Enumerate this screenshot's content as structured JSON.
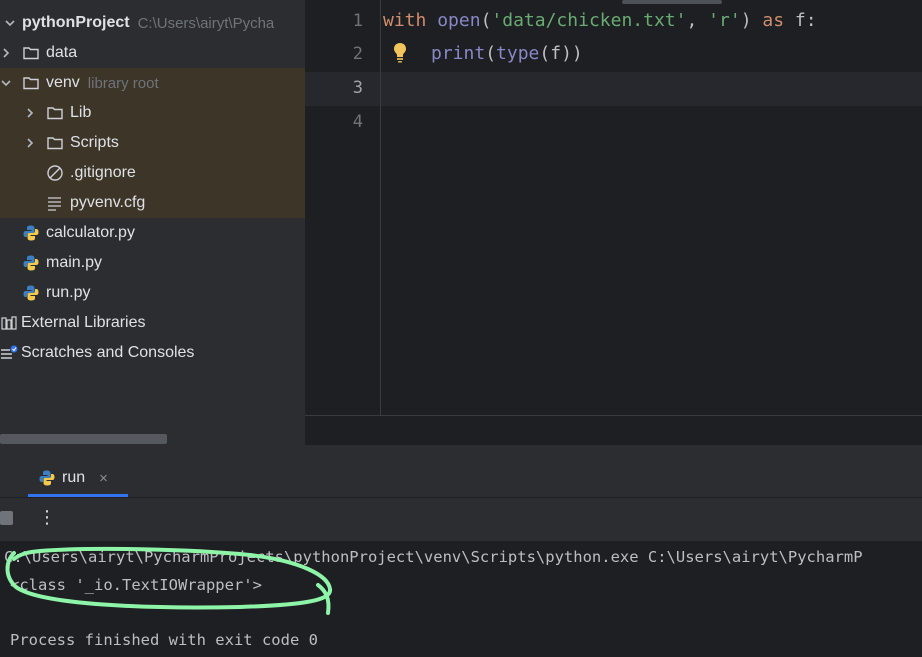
{
  "project": {
    "root_name": "pythonProject",
    "root_path": "C:\\Users\\airyt\\Pycha",
    "items": [
      {
        "label": "data",
        "icon": "folder-icon"
      },
      {
        "label": "venv",
        "sub": "library root",
        "icon": "folder-icon"
      },
      {
        "label": "Lib",
        "icon": "folder-icon"
      },
      {
        "label": "Scripts",
        "icon": "folder-icon"
      },
      {
        "label": ".gitignore",
        "icon": "ignore-file-icon"
      },
      {
        "label": "pyvenv.cfg",
        "icon": "text-file-icon"
      },
      {
        "label": "calculator.py",
        "icon": "python-file-icon"
      },
      {
        "label": "main.py",
        "icon": "python-file-icon"
      },
      {
        "label": "run.py",
        "icon": "python-file-icon"
      },
      {
        "label": "External Libraries",
        "icon": "library-icon"
      },
      {
        "label": "Scratches and Consoles",
        "icon": "scratches-icon"
      }
    ]
  },
  "editor": {
    "line_numbers": [
      "1",
      "2",
      "3",
      "4"
    ],
    "line1": {
      "kw_with": "with",
      "fn_open": "open",
      "p_open": "(",
      "str_path": "'data/chicken.txt'",
      "comma": ", ",
      "str_mode": "'r'",
      "p_close": ")",
      "kw_as": "as",
      "rest": "f:"
    },
    "line2": {
      "fn_print": "print",
      "p1": "(",
      "fn_type": "type",
      "p2": "(f))"
    }
  },
  "run": {
    "tab_label": "run",
    "close_glyph": "×",
    "more_glyph": "⋮",
    "console_lines": [
      "C:\\Users\\airyt\\PycharmProjects\\pythonProject\\venv\\Scripts\\python.exe C:\\Users\\airyt\\PycharmP",
      "<class '_io.TextIOWrapper'>",
      "Process finished with exit code 0"
    ]
  },
  "colors": {
    "highlight_annotation": "#8ef5a8",
    "keyword": "#cf8e6d",
    "string": "#6aab73",
    "function": "#56a8f5",
    "builtin": "#8888c6",
    "venv_highlight": "#3c3528"
  }
}
